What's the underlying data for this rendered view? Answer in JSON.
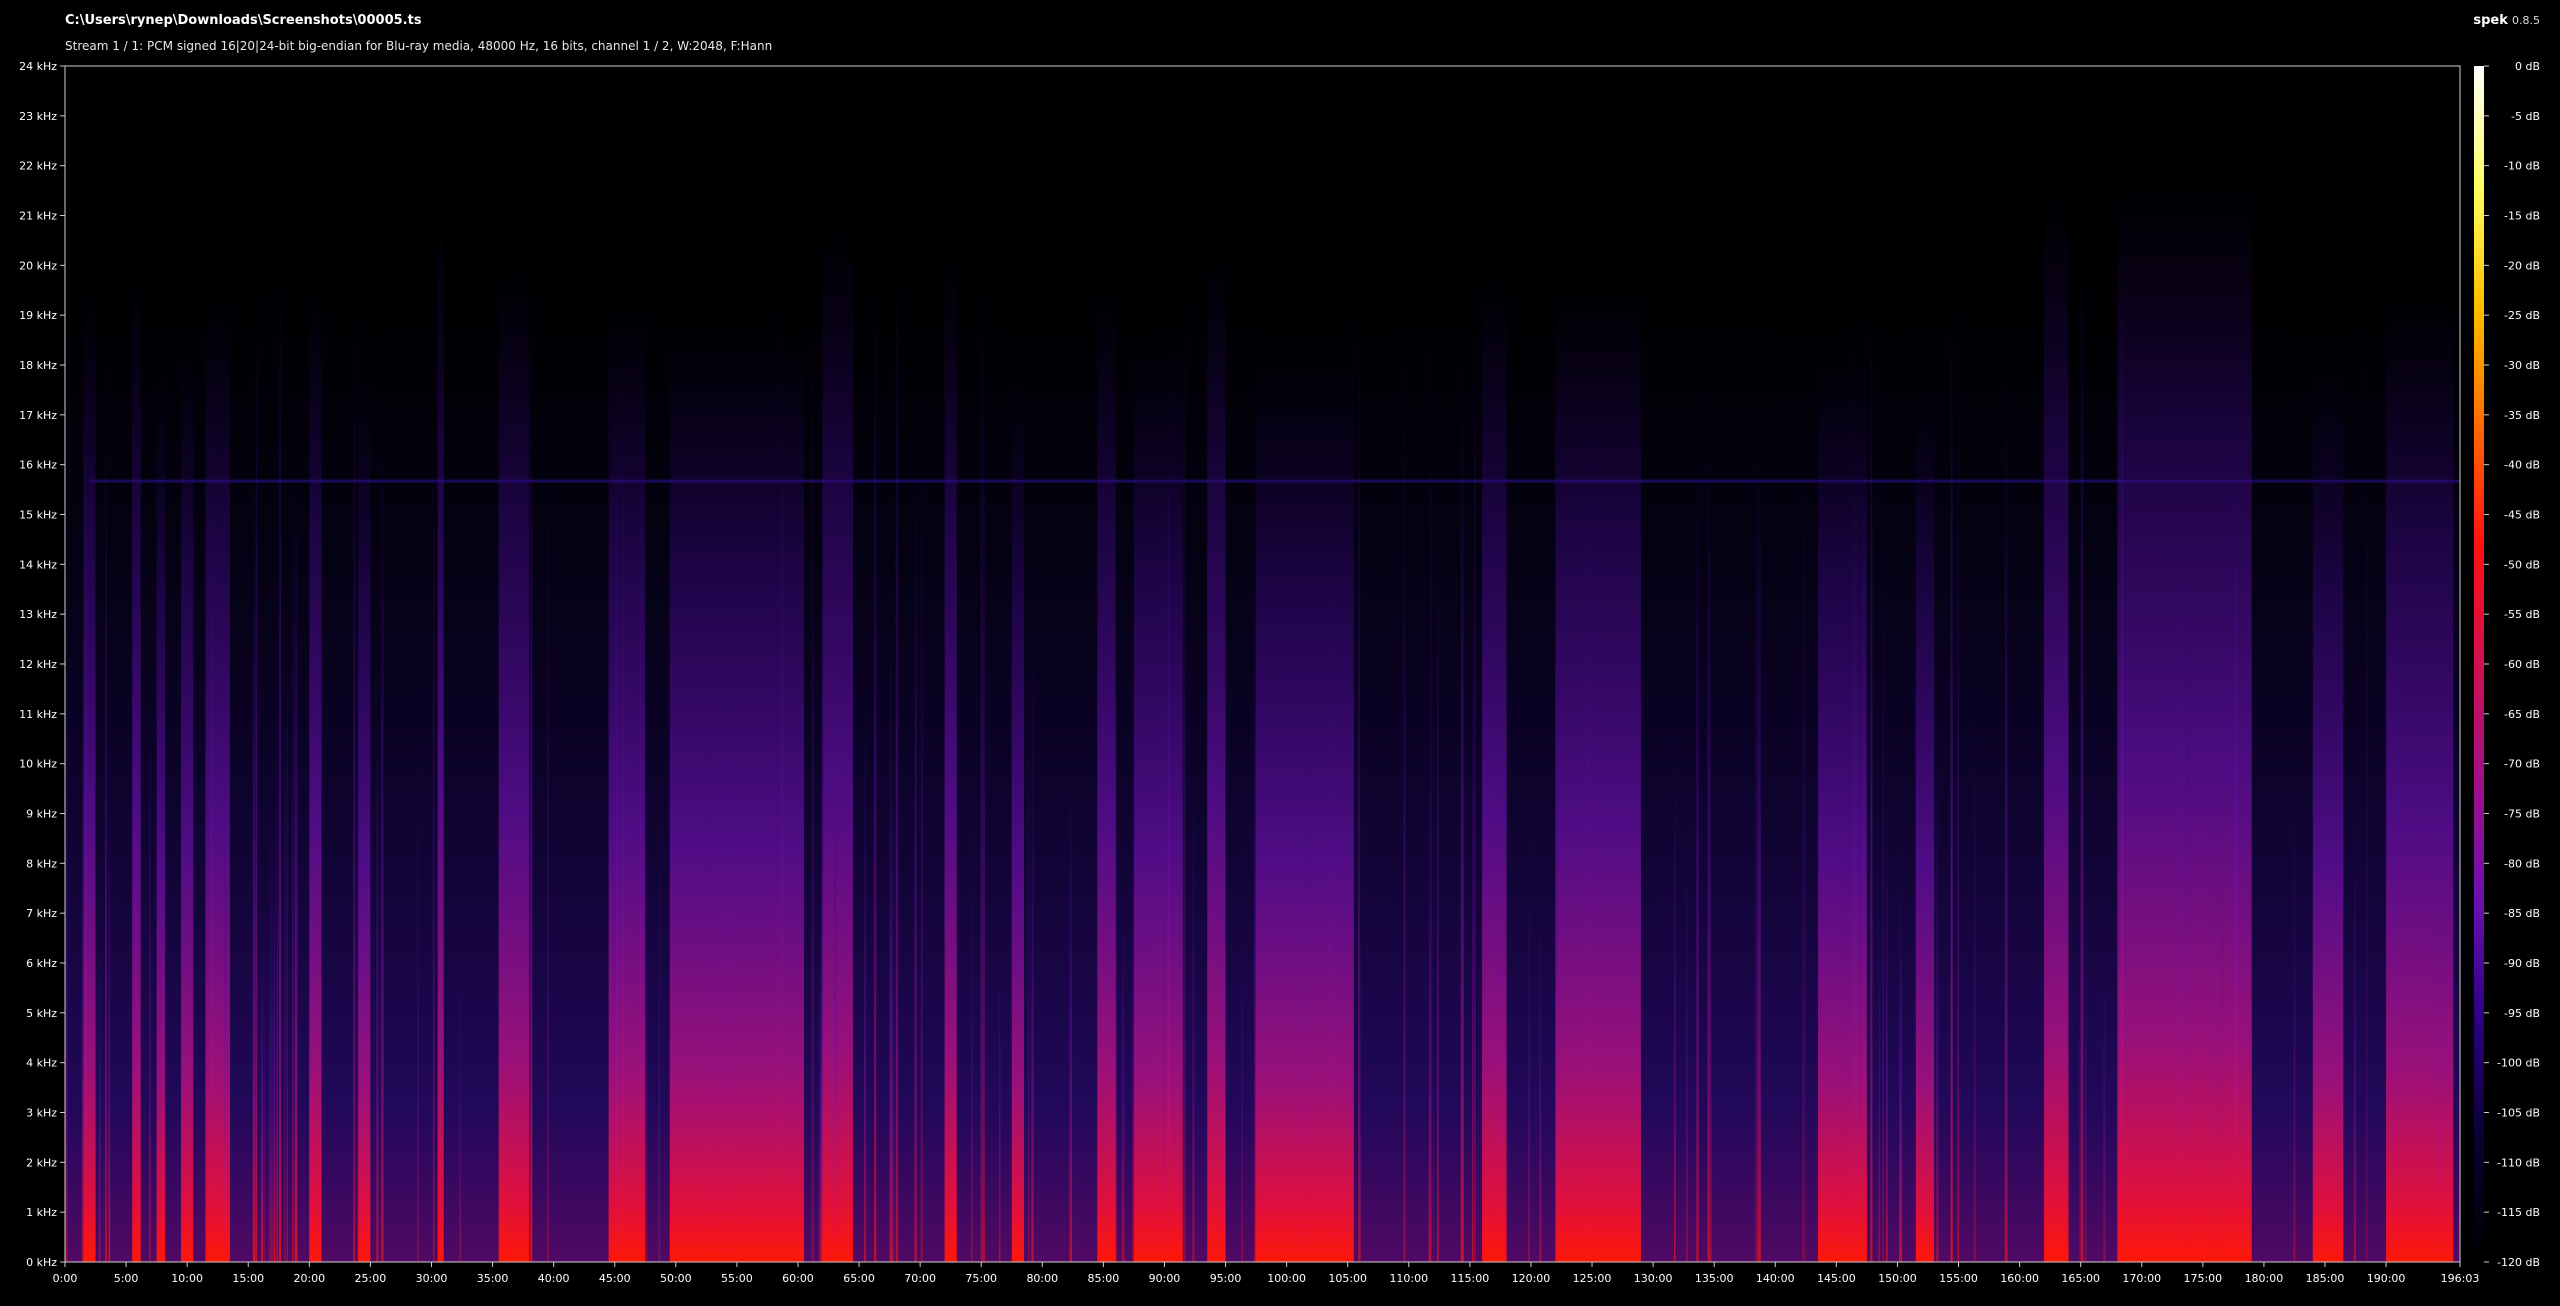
{
  "window": {
    "file_path": "C:\\Users\\rynep\\Downloads\\Screenshots\\00005.ts",
    "stream_info": "Stream 1 / 1: PCM signed 16|20|24-bit big-endian for Blu-ray media, 48000 Hz, 16 bits, channel 1 / 2, W:2048, F:Hann",
    "app_name": "spek",
    "app_version": "0.8.5"
  },
  "chart_data": {
    "type": "heatmap",
    "title": "",
    "xlabel": "",
    "ylabel": "",
    "x_range_minutes": [
      0,
      196.05
    ],
    "y_range_khz": [
      0,
      24
    ],
    "db_range": [
      -120,
      0
    ],
    "x_tick_labels": [
      "0:00",
      "5:00",
      "10:00",
      "15:00",
      "20:00",
      "25:00",
      "30:00",
      "35:00",
      "40:00",
      "45:00",
      "50:00",
      "55:00",
      "60:00",
      "65:00",
      "70:00",
      "75:00",
      "80:00",
      "85:00",
      "90:00",
      "95:00",
      "100:00",
      "105:00",
      "110:00",
      "115:00",
      "120:00",
      "125:00",
      "130:00",
      "135:00",
      "140:00",
      "145:00",
      "150:00",
      "155:00",
      "160:00",
      "165:00",
      "170:00",
      "175:00",
      "180:00",
      "185:00",
      "190:00",
      "196:03"
    ],
    "y_tick_labels": [
      "0 kHz",
      "1 kHz",
      "2 kHz",
      "3 kHz",
      "4 kHz",
      "5 kHz",
      "6 kHz",
      "7 kHz",
      "8 kHz",
      "9 kHz",
      "10 kHz",
      "11 kHz",
      "12 kHz",
      "13 kHz",
      "14 kHz",
      "15 kHz",
      "16 kHz",
      "17 kHz",
      "18 kHz",
      "19 kHz",
      "20 kHz",
      "21 kHz",
      "22 kHz",
      "23 kHz",
      "24 kHz"
    ],
    "db_tick_labels": [
      "0 dB",
      "-5 dB",
      "-10 dB",
      "-15 dB",
      "-20 dB",
      "-25 dB",
      "-30 dB",
      "-35 dB",
      "-40 dB",
      "-45 dB",
      "-50 dB",
      "-55 dB",
      "-60 dB",
      "-65 dB",
      "-70 dB",
      "-75 dB",
      "-80 dB",
      "-85 dB",
      "-90 dB",
      "-95 dB",
      "-100 dB",
      "-105 dB",
      "-110 dB",
      "-115 dB",
      "-120 dB"
    ],
    "colormap": [
      "#000000",
      "#0a0030",
      "#2a0080",
      "#6a10b0",
      "#a0108a",
      "#d01050",
      "#ff1010",
      "#ff6a00",
      "#ffc000",
      "#ffff60",
      "#ffffff"
    ],
    "loud_segments_minutes": [
      [
        1.5,
        2.5
      ],
      [
        5.5,
        6.2
      ],
      [
        7.5,
        8.2
      ],
      [
        9.5,
        10.5
      ],
      [
        11.5,
        13.5
      ],
      [
        20,
        21
      ],
      [
        24,
        25
      ],
      [
        30.5,
        31
      ],
      [
        35.5,
        38
      ],
      [
        44.5,
        47.5
      ],
      [
        49.5,
        60.5
      ],
      [
        62,
        64.5
      ],
      [
        72,
        73
      ],
      [
        77.5,
        78.5
      ],
      [
        84.5,
        86
      ],
      [
        87.5,
        91.5
      ],
      [
        93.5,
        95
      ],
      [
        97.5,
        105.5
      ],
      [
        116,
        118
      ],
      [
        122,
        129
      ],
      [
        143.5,
        147.5
      ],
      [
        151.5,
        153
      ],
      [
        162,
        164
      ],
      [
        168,
        179
      ],
      [
        184,
        186.5
      ],
      [
        190,
        195.5
      ]
    ]
  }
}
